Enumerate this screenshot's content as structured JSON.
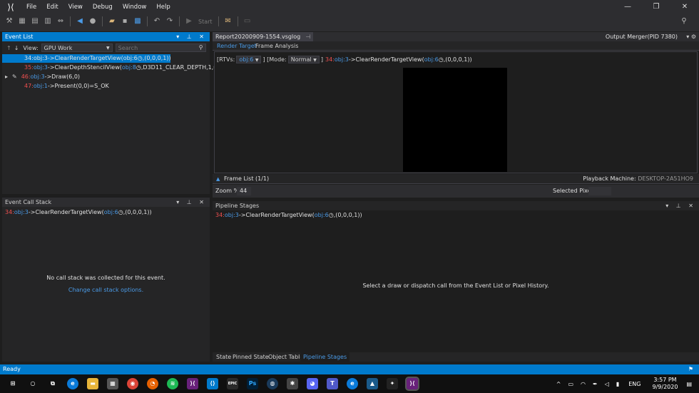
{
  "menu": [
    "File",
    "Edit",
    "View",
    "Debug",
    "Window",
    "Help"
  ],
  "toolbar": {
    "start_label": "Start"
  },
  "event_list": {
    "title": "Event List",
    "view_label": "View:",
    "view_value": "GPU Work",
    "search_placeholder": "Search",
    "items": [
      {
        "num": "34:",
        "obj": "obj:3",
        "text": "->ClearRenderTargetView(",
        "arg": "obj:6",
        "rest": ",(0,0,0,1))"
      },
      {
        "num": "35:",
        "obj": "obj:3",
        "text": "->ClearDepthStencilView(",
        "arg": "obj:8",
        "rest": ",D3D11_CLEAR_DEPTH,1,0)"
      },
      {
        "num": "46:",
        "obj": "obj:3",
        "text": "->Draw(6,0)",
        "arg": "",
        "rest": ""
      },
      {
        "num": "47:",
        "obj": "obj:1",
        "text": "->Present(0,0)=S_OK",
        "arg": "",
        "rest": ""
      }
    ]
  },
  "doc_tab": {
    "label": "Report20200909-1554.vsglog"
  },
  "output_merger": "Output Merger(PID 7380)",
  "rt_tabs": [
    "Render Target",
    "Frame Analysis"
  ],
  "rt_bar": {
    "rtvs_label": "[RTVs:",
    "rtvs_value": "obj:6",
    "mode_label": "] [Mode:",
    "mode_value": "Normal",
    "call_num": "34:",
    "call_obj": "obj:3",
    "call_text": "->ClearRenderTargetView(",
    "call_arg": "obj:6",
    "call_rest": ",(0,0,0,1))"
  },
  "frame_list": {
    "label": "Frame List (1/1)",
    "playback_label": "Playback Machine:",
    "playback_value": "DESKTOP-2A51HO9"
  },
  "zoom": {
    "label": "Zoom %",
    "value": "44",
    "selected_pixel": "Selected Pixel"
  },
  "call_stack": {
    "title": "Event Call Stack",
    "line": {
      "num": "34:",
      "obj": "obj:3",
      "text": "->ClearRenderTargetView(",
      "arg": "obj:6",
      "rest": ",(0,0,0,1))"
    },
    "empty_msg": "No call stack was collected for this event.",
    "change_link": "Change call stack options."
  },
  "pipeline": {
    "title": "Pipeline Stages",
    "line": {
      "num": "34:",
      "obj": "obj:3",
      "text": "->ClearRenderTargetView(",
      "arg": "obj:6",
      "rest": ",(0,0,0,1))"
    },
    "msg": "Select a draw or dispatch call from the Event List or Pixel History.",
    "bottom_tabs": [
      "State",
      "Pinned State",
      "Object Table",
      "Pipeline Stages"
    ]
  },
  "status": "Ready",
  "tray": {
    "lang": "ENG",
    "time": "3:57 PM",
    "date": "9/9/2020"
  }
}
